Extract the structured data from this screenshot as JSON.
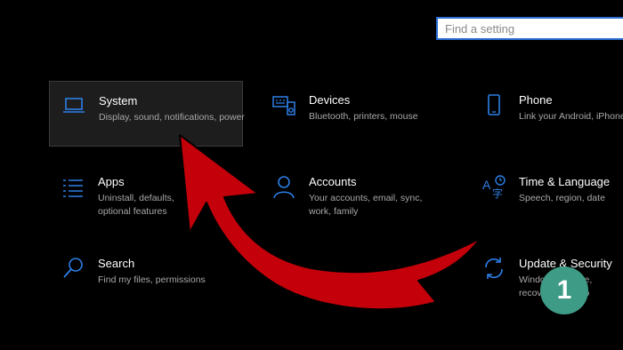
{
  "search": {
    "placeholder": "Find a setting"
  },
  "colors": {
    "accent": "#2d7fe6",
    "background": "#000000",
    "arrow": "#c4000a",
    "badge": "#3e9b86"
  },
  "tiles": [
    {
      "title": "System",
      "desc": "Display, sound, notifications, power",
      "icon": "laptop-icon",
      "selected": true
    },
    {
      "title": "Devices",
      "desc": "Bluetooth, printers, mouse",
      "icon": "keyboard-speaker-icon"
    },
    {
      "title": "Phone",
      "desc": "Link your Android, iPhone",
      "icon": "phone-icon"
    },
    {
      "title": "Apps",
      "desc": "Uninstall, defaults, optional features",
      "icon": "apps-list-icon"
    },
    {
      "title": "Accounts",
      "desc": "Your accounts, email, sync, work, family",
      "icon": "person-icon"
    },
    {
      "title": "Time & Language",
      "desc": "Speech, region, date",
      "icon": "time-language-icon"
    },
    {
      "title": "Search",
      "desc": "Find my files, permissions",
      "icon": "search-icon"
    },
    {
      "title": "",
      "desc": "",
      "icon": "blank-icon"
    },
    {
      "title": "Update & Security",
      "desc": "Windows Update, recovery, backup",
      "icon": "sync-icon"
    }
  ],
  "annotation": {
    "step": "1"
  }
}
